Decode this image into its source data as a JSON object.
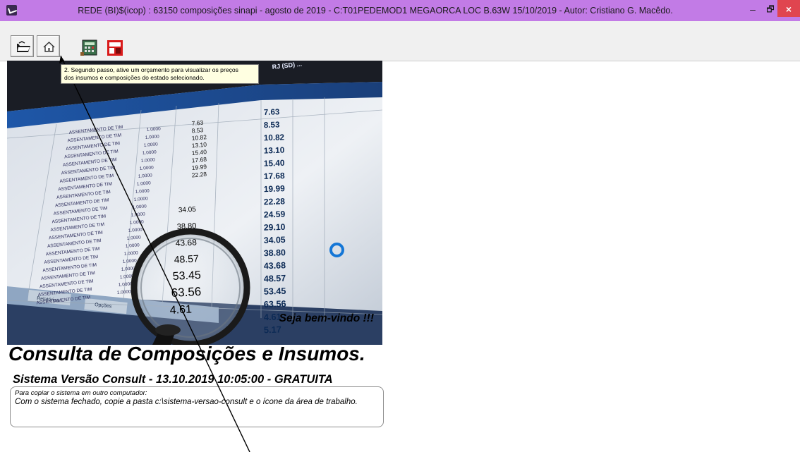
{
  "window": {
    "title": "REDE  (BI)$(icop) : 63150 composições sinapi - agosto de 2019 - C:T01PEDEMOD1 MEGAORCA LOC B.63W 15/10/2019 - Autor: Cristiano G. Macêdo.",
    "minimize_glyph": "–",
    "maximize_glyph": "🗗",
    "close_glyph": "×",
    "accent_color": "#c27be6"
  },
  "toolbar": {
    "buttons": [
      {
        "icon": "open-folder-icon"
      },
      {
        "icon": "home-icon"
      },
      {
        "icon": "calculator-icon"
      },
      {
        "icon": "red-chart-icon"
      }
    ]
  },
  "tooltip": {
    "line1": "2. Segundo passo, ative um orçamento para visualizar os preços",
    "line2": "dos insumos e composições do estado selecionado."
  },
  "photo": {
    "welcome_text": "Seja bem-vindo !!!",
    "header_text": "RJ (SD) ...",
    "right_column_values": [
      "7.63",
      "8.53",
      "10.82",
      "13.10",
      "15.40",
      "17.68",
      "19.99",
      "22.28",
      "24.59",
      "29.10",
      "34.05",
      "38.80",
      "43.68",
      "48.57",
      "53.45",
      "63.56",
      "4.61",
      "5.17"
    ],
    "left_column_values": [
      "7.63",
      "8.53",
      "10.82",
      "13.10",
      "15.40",
      "17.68",
      "19.99",
      "22.28"
    ],
    "magnified_values": [
      "34.05",
      "38.80",
      "43.68",
      "48.57",
      "53.45",
      "63.56",
      "4.61"
    ],
    "row_label": "ASSENTAMENTO DE TIM",
    "quantity": "1.0000",
    "bottom_buttons": [
      "Relatórios",
      "Opções"
    ]
  },
  "main": {
    "heading": "Consulta de Composições e Insumos.",
    "version": "Sistema Versão Consult - 13.10.2019 10:05:00 - GRATUITA",
    "note_label": "Para copiar o sistema em outro computador:",
    "note_text": "Com o sistema fechado, copie a pasta c:\\sistema-versao-consult  e  o ícone da área de trabalho."
  }
}
